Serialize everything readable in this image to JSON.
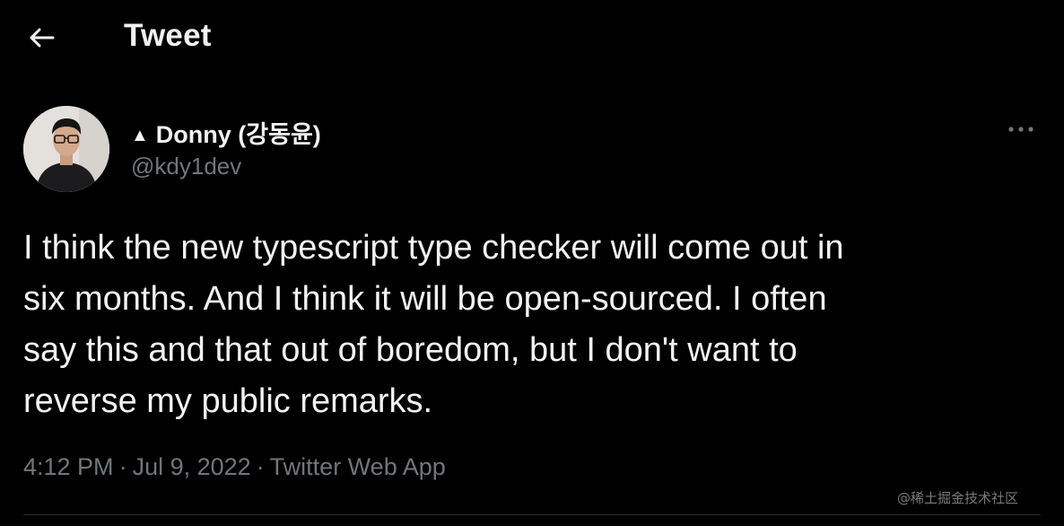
{
  "header": {
    "title": "Tweet",
    "back_icon": "arrow-left-icon"
  },
  "author": {
    "name": "Donny (강동윤)",
    "verified_glyph": "▲",
    "handle": "@kdy1dev",
    "avatar_icon": "avatar-photo"
  },
  "tweet": {
    "text": "I think the new typescript type checker will come out in\nsix months. And I think it will be open-sourced. I often\nsay this and that out of boredom, but I don't want to\nreverse my public remarks.",
    "time": "4:12 PM",
    "separator": "·",
    "date": "Jul 9, 2022",
    "source": "Twitter Web App"
  },
  "actions": {
    "more_icon": "more-horizontal-icon"
  },
  "watermark": "@稀土掘金技术社区",
  "colors": {
    "background": "#000000",
    "primary_text": "#f2f2f2",
    "secondary_text": "#71767b",
    "divider": "#2f3336"
  }
}
